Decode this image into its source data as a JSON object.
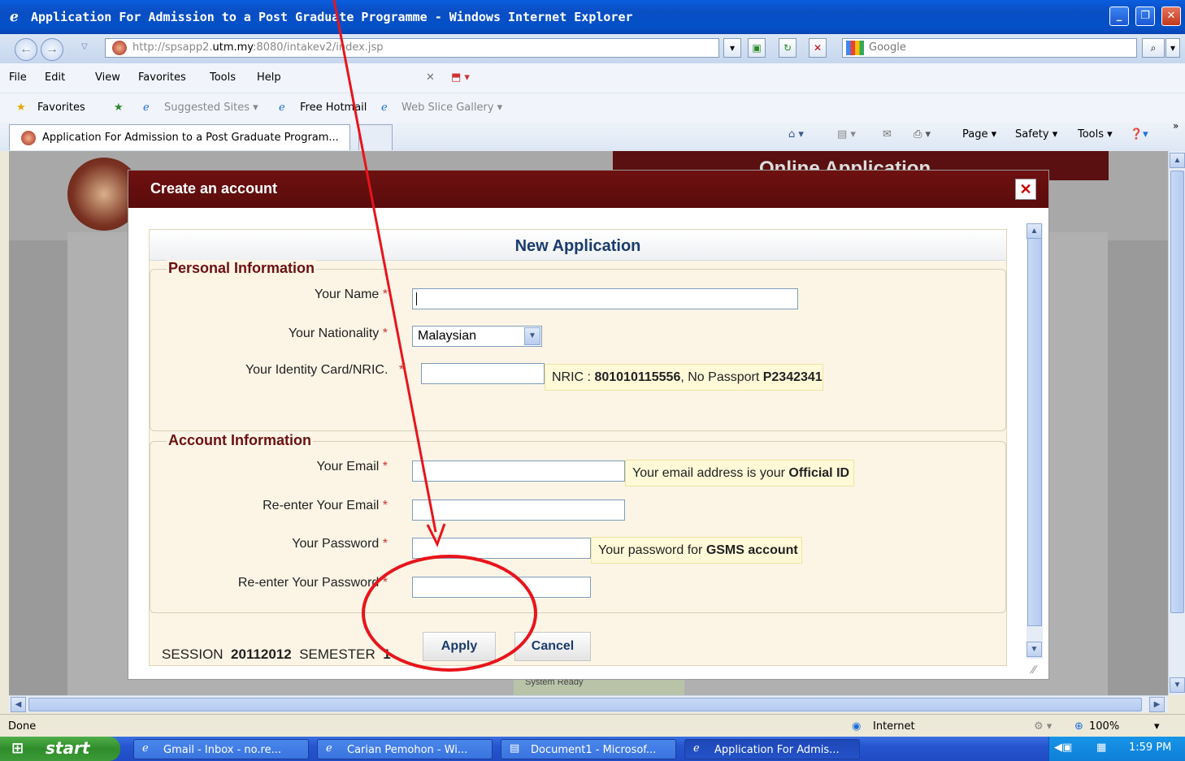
{
  "window": {
    "title": "Application For Admission to a Post Graduate Programme - Windows Internet Explorer"
  },
  "addressbar": {
    "url_prefix": "http://spsapp2.",
    "url_domain": "utm.my",
    "url_suffix": ":8080/intakev2/index.jsp",
    "search_placeholder": "Google"
  },
  "menu": {
    "items": [
      "File",
      "Edit",
      "View",
      "Favorites",
      "Tools",
      "Help"
    ]
  },
  "favorites": {
    "label": "Favorites",
    "links": [
      "Suggested Sites ▾",
      "Free Hotmail",
      "Web Slice Gallery ▾"
    ]
  },
  "tab": {
    "title": "Application For Admission to a Post Graduate Program..."
  },
  "commandbar": {
    "page": "Page ▾",
    "safety": "Safety ▾",
    "tools": "Tools ▾"
  },
  "page_bg": {
    "banner_text": "Online Application",
    "status_text": "System Ready"
  },
  "modal": {
    "title": "Create an account",
    "heading": "New Application",
    "personal": {
      "legend": "Personal Information",
      "name_label": "Your Name",
      "nationality_label": "Your Nationality",
      "nationality_value": "Malaysian",
      "ic_label": "Your Identity Card/NRIC.",
      "ic_hint_prefix": "NRIC : ",
      "ic_hint_nric": "801010115556",
      "ic_hint_mid": ", No Passport ",
      "ic_hint_passport": "P2342341"
    },
    "account": {
      "legend": "Account Information",
      "email_label": "Your Email",
      "email_hint_prefix": "Your email address is your ",
      "email_hint_bold": "Official ID",
      "reemail_label": "Re-enter Your Email",
      "password_label": "Your Password",
      "password_hint_prefix": "Your password for ",
      "password_hint_bold": "GSMS account",
      "repassword_label": "Re-enter Your Password"
    },
    "session_label": "SESSION",
    "session_value": "20112012",
    "semester_label": "SEMESTER",
    "semester_value": "1",
    "apply_label": "Apply",
    "cancel_label": "Cancel",
    "required_mark": "*"
  },
  "status": {
    "left": "Done",
    "zone": "Internet",
    "zoom": "100%"
  },
  "taskbar": {
    "start": "start",
    "items": [
      "Gmail - Inbox - no.re...",
      "Carian Pemohon - Wi...",
      "Document1 - Microsof...",
      "Application For Admis..."
    ],
    "time": "1:59 PM"
  },
  "annotation": {
    "arrow_color": "#e8141b",
    "circle_color": "#e8141b"
  }
}
